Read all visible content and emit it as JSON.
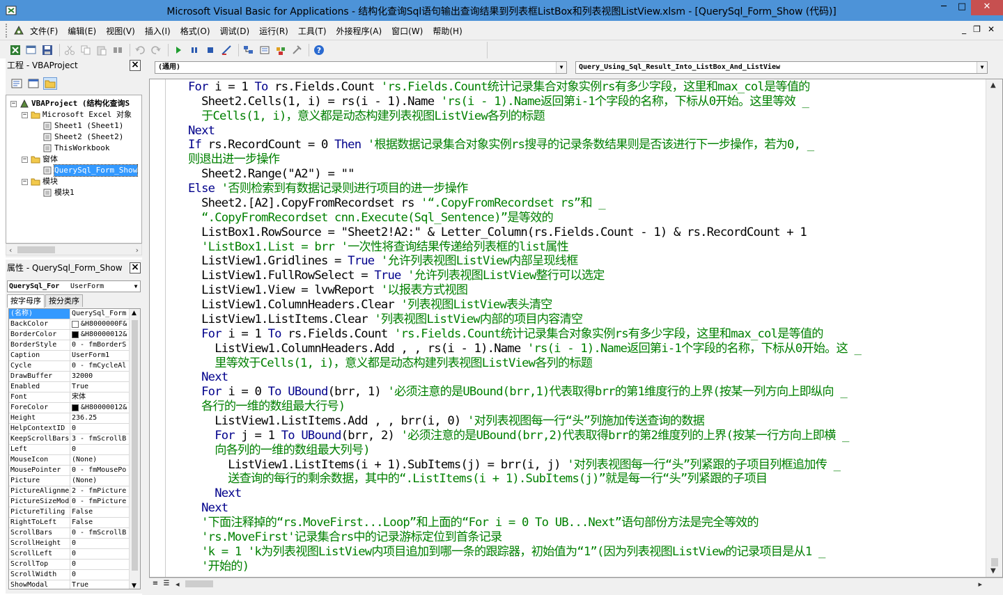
{
  "window": {
    "title": "Microsoft Visual Basic for Applications - 结构化查询Sql语句输出查询结果到列表框ListBox和列表视图ListView.xlsm - [QuerySql_Form_Show (代码)]",
    "minimize": "─",
    "maximize": "□",
    "close": "✕"
  },
  "menu": {
    "items": [
      "文件(F)",
      "编辑(E)",
      "视图(V)",
      "插入(I)",
      "格式(O)",
      "调试(D)",
      "运行(R)",
      "工具(T)",
      "外接程序(A)",
      "窗口(W)",
      "帮助(H)"
    ],
    "mdi_minimize": "_",
    "mdi_restore": "❐",
    "mdi_close": "✕"
  },
  "toolbar": {
    "icons": [
      "excel-view-icon",
      "insert-userform-icon",
      "save-icon",
      "cut-icon",
      "copy-icon",
      "paste-icon",
      "find-icon",
      "undo-icon",
      "redo-icon",
      "run-icon",
      "break-icon",
      "reset-icon",
      "design-mode-icon",
      "project-explorer-icon",
      "properties-window-icon",
      "object-browser-icon",
      "toolbox-icon",
      "help-icon"
    ]
  },
  "project_pane": {
    "title": "工程 - VBAProject",
    "tree": [
      {
        "label": "VBAProject (结构化查询S",
        "level": 0,
        "expander": "−",
        "bold": true
      },
      {
        "label": "Microsoft Excel 对象",
        "level": 1,
        "expander": "−"
      },
      {
        "label": "Sheet1 (Sheet1)",
        "level": 2,
        "expander": ""
      },
      {
        "label": "Sheet2 (Sheet2)",
        "level": 2,
        "expander": ""
      },
      {
        "label": "ThisWorkbook",
        "level": 2,
        "expander": ""
      },
      {
        "label": "窗体",
        "level": 1,
        "expander": "−"
      },
      {
        "label": "QuerySql_Form_Show",
        "level": 2,
        "expander": "",
        "selected": true
      },
      {
        "label": "模块",
        "level": 1,
        "expander": "−"
      },
      {
        "label": "模块1",
        "level": 2,
        "expander": ""
      }
    ]
  },
  "properties_pane": {
    "title": "属性 - QuerySql_Form_Show",
    "object_name": "QuerySql_For",
    "object_type": "UserForm",
    "tabs": [
      "按字母序",
      "按分类序"
    ],
    "rows": [
      {
        "name": "(名称)",
        "value": "QuerySql_Form",
        "selected": true
      },
      {
        "name": "BackColor",
        "value": "&H8000000F&",
        "swatch": "#ffffff"
      },
      {
        "name": "BorderColor",
        "value": "&H80000012&",
        "swatch": "#000000"
      },
      {
        "name": "BorderStyle",
        "value": "0 - fmBorderS"
      },
      {
        "name": "Caption",
        "value": "UserForm1"
      },
      {
        "name": "Cycle",
        "value": "0 - fmCycleAl"
      },
      {
        "name": "DrawBuffer",
        "value": "32000"
      },
      {
        "name": "Enabled",
        "value": "True"
      },
      {
        "name": "Font",
        "value": "宋体"
      },
      {
        "name": "ForeColor",
        "value": "&H80000012&",
        "swatch": "#000000"
      },
      {
        "name": "Height",
        "value": "236.25"
      },
      {
        "name": "HelpContextID",
        "value": "0"
      },
      {
        "name": "KeepScrollBars",
        "value": "3 - fmScrollB"
      },
      {
        "name": "Left",
        "value": "0"
      },
      {
        "name": "MouseIcon",
        "value": "(None)"
      },
      {
        "name": "MousePointer",
        "value": "0 - fmMousePo"
      },
      {
        "name": "Picture",
        "value": "(None)"
      },
      {
        "name": "PictureAlignme",
        "value": "2 - fmPicture"
      },
      {
        "name": "PictureSizeMod",
        "value": "0 - fmPicture"
      },
      {
        "name": "PictureTiling",
        "value": "False"
      },
      {
        "name": "RightToLeft",
        "value": "False"
      },
      {
        "name": "ScrollBars",
        "value": "0 - fmScrollB"
      },
      {
        "name": "ScrollHeight",
        "value": "0"
      },
      {
        "name": "ScrollLeft",
        "value": "0"
      },
      {
        "name": "ScrollTop",
        "value": "0"
      },
      {
        "name": "ScrollWidth",
        "value": "0"
      },
      {
        "name": "ShowModal",
        "value": "True"
      }
    ]
  },
  "code_window": {
    "object_combo": "(通用)",
    "procedure_combo": "Query_Using_Sql_Result_Into_ListBox_And_ListView",
    "lines": [
      [
        {
          "t": "For",
          "c": "kw"
        },
        {
          "t": " i = 1 "
        },
        {
          "t": "To",
          "c": "kw"
        },
        {
          "t": " rs.Fields.Count "
        },
        {
          "t": "'rs.Fields.Count统计记录集合对象实例rs有多少字段，这里和max_col是等值的",
          "c": "cm"
        }
      ],
      [
        {
          "t": "  Sheet2.Cells(1, i) = rs(i - 1).Name "
        },
        {
          "t": "'rs(i - 1).Name返回第i-1个字段的名称，下标从0开始。这里等效 _",
          "c": "cm"
        }
      ],
      [
        {
          "t": "  于Cells(1, i)，意义都是动态构建列表视图ListView各列的标题",
          "c": "cm"
        }
      ],
      [
        {
          "t": "Next",
          "c": "kw"
        }
      ],
      [
        {
          "t": "If",
          "c": "kw"
        },
        {
          "t": " rs.RecordCount = 0 "
        },
        {
          "t": "Then",
          "c": "kw"
        },
        {
          "t": " "
        },
        {
          "t": "'根据数据记录集合对象实例rs搜寻的记录条数结果则是否该进行下一步操作，若为0, _",
          "c": "cm"
        }
      ],
      [
        {
          "t": "则退出进一步操作",
          "c": "cm"
        }
      ],
      [
        {
          "t": "  Sheet2.Range(\"A2\") = \"\""
        }
      ],
      [
        {
          "t": "Else",
          "c": "kw"
        },
        {
          "t": " "
        },
        {
          "t": "'否则检索到有数据记录则进行项目的进一步操作",
          "c": "cm"
        }
      ],
      [
        {
          "t": "  Sheet2.[A2].CopyFromRecordset rs "
        },
        {
          "t": "'“.CopyFromRecordset rs”和 _",
          "c": "cm"
        }
      ],
      [
        {
          "t": "  “.CopyFromRecordset cnn.Execute(Sql_Sentence)”是等效的",
          "c": "cm"
        }
      ],
      [
        {
          "t": "  ListBox1.RowSource = \"Sheet2!A2:\" & Letter_Column(rs.Fields.Count - 1) & rs.RecordCount + 1"
        }
      ],
      [
        {
          "t": "  'ListBox1.List = brr '一次性将查询结果传递给列表框的list属性",
          "c": "cm"
        }
      ],
      [
        {
          "t": "  ListView1.Gridlines = "
        },
        {
          "t": "True",
          "c": "kw"
        },
        {
          "t": " "
        },
        {
          "t": "'允许列表视图ListView内部呈现线框",
          "c": "cm"
        }
      ],
      [
        {
          "t": "  ListView1.FullRowSelect = "
        },
        {
          "t": "True",
          "c": "kw"
        },
        {
          "t": " "
        },
        {
          "t": "'允许列表视图ListView整行可以选定",
          "c": "cm"
        }
      ],
      [
        {
          "t": "  ListView1.View = lvwReport "
        },
        {
          "t": "'以报表方式视图",
          "c": "cm"
        }
      ],
      [
        {
          "t": "  ListView1.ColumnHeaders.Clear "
        },
        {
          "t": "'列表视图ListView表头清空",
          "c": "cm"
        }
      ],
      [
        {
          "t": "  ListView1.ListItems.Clear "
        },
        {
          "t": "'列表视图ListView内部的项目内容清空",
          "c": "cm"
        }
      ],
      [
        {
          "t": "  "
        },
        {
          "t": "For",
          "c": "kw"
        },
        {
          "t": " i = 1 "
        },
        {
          "t": "To",
          "c": "kw"
        },
        {
          "t": " rs.Fields.Count "
        },
        {
          "t": "'rs.Fields.Count统计记录集合对象实例rs有多少字段，这里和max_col是等值的",
          "c": "cm"
        }
      ],
      [
        {
          "t": "    ListView1.ColumnHeaders.Add , , rs(i - 1).Name "
        },
        {
          "t": "'rs(i - 1).Name返回第i-1个字段的名称，下标从0开始。这 _",
          "c": "cm"
        }
      ],
      [
        {
          "t": "    里等效于Cells(1, i)，意义都是动态构建列表视图ListView各列的标题",
          "c": "cm"
        }
      ],
      [
        {
          "t": "  "
        },
        {
          "t": "Next",
          "c": "kw"
        }
      ],
      [
        {
          "t": "  "
        },
        {
          "t": "For",
          "c": "kw"
        },
        {
          "t": " i = 0 "
        },
        {
          "t": "To",
          "c": "kw"
        },
        {
          "t": " "
        },
        {
          "t": "UBound",
          "c": "kw"
        },
        {
          "t": "(brr, 1) "
        },
        {
          "t": "'必须注意的是UBound(brr,1)代表取得brr的第1维度行的上界(按某一列方向上即纵向 _",
          "c": "cm"
        }
      ],
      [
        {
          "t": "  各行的一维的数组最大行号)",
          "c": "cm"
        }
      ],
      [
        {
          "t": "    ListView1.ListItems.Add , , brr(i, 0) "
        },
        {
          "t": "'对列表视图每一行“头”列施加传送查询的数据",
          "c": "cm"
        }
      ],
      [
        {
          "t": "    "
        },
        {
          "t": "For",
          "c": "kw"
        },
        {
          "t": " j = 1 "
        },
        {
          "t": "To",
          "c": "kw"
        },
        {
          "t": " "
        },
        {
          "t": "UBound",
          "c": "kw"
        },
        {
          "t": "(brr, 2) "
        },
        {
          "t": "'必须注意的是UBound(brr,2)代表取得brr的第2维度列的上界(按某一行方向上即横 _",
          "c": "cm"
        }
      ],
      [
        {
          "t": "    向各列的一维的数组最大列号)",
          "c": "cm"
        }
      ],
      [
        {
          "t": "      ListView1.ListItems(i + 1).SubItems(j) = brr(i, j) "
        },
        {
          "t": "'对列表视图每一行“头”列紧跟的子项目列框追加传 _",
          "c": "cm"
        }
      ],
      [
        {
          "t": "      送查询的每行的剩余数据，其中的“.ListItems(i + 1).SubItems(j)”就是每一行“头”列紧跟的子项目",
          "c": "cm"
        }
      ],
      [
        {
          "t": "    "
        },
        {
          "t": "Next",
          "c": "kw"
        }
      ],
      [
        {
          "t": "  "
        },
        {
          "t": "Next",
          "c": "kw"
        }
      ],
      [
        {
          "t": "  '下面注释掉的“rs.MoveFirst...Loop”和上面的“For i = 0 To UB...Next”语句部份方法是完全等效的",
          "c": "cm"
        }
      ],
      [
        {
          "t": "  'rs.MoveFirst'记录集合rs中的记录游标定位到首条记录",
          "c": "cm"
        }
      ],
      [
        {
          "t": "  'k = 1 'k为列表视图ListView内项目追加到哪一条的跟踪器，初始值为“1”(因为列表视图ListView的记录项目是从1 _",
          "c": "cm"
        }
      ],
      [
        {
          "t": "  '开始的)",
          "c": "cm"
        }
      ]
    ]
  }
}
